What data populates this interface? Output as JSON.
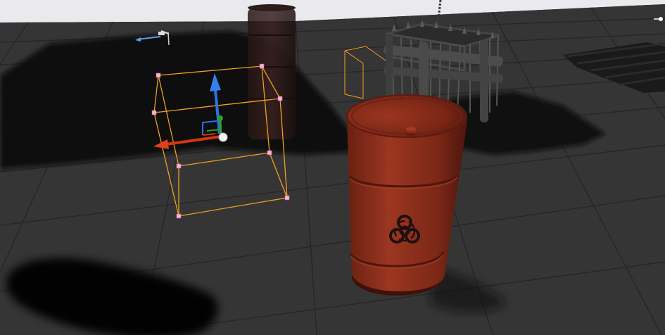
{
  "viewport": {
    "mode": "perspective",
    "colors": {
      "floor": "#343434",
      "grid_line": "#232323",
      "sky": "#e9e9ee",
      "shadow": "#050505",
      "selection_box": "#f0a020",
      "box_vertex": "#f2a6d2",
      "barrel_red": "#8e2f1d",
      "gizmo_x": "#d3360f",
      "gizmo_y": "#2ca02c",
      "gizmo_z": "#2a74e0"
    }
  },
  "scene_objects": {
    "selected_actor": {
      "icon": "trigger-box-icon",
      "selected": true
    },
    "transform_gizmo": {
      "icon": "move-gizmo-icon",
      "axes": [
        "x",
        "y",
        "z"
      ]
    },
    "red_barrel": {
      "icon": "biohazard-icon"
    },
    "background_barrel": {},
    "cage": {},
    "light_source_icon": {
      "icon": "directional-light-icon"
    },
    "pallet": {}
  }
}
